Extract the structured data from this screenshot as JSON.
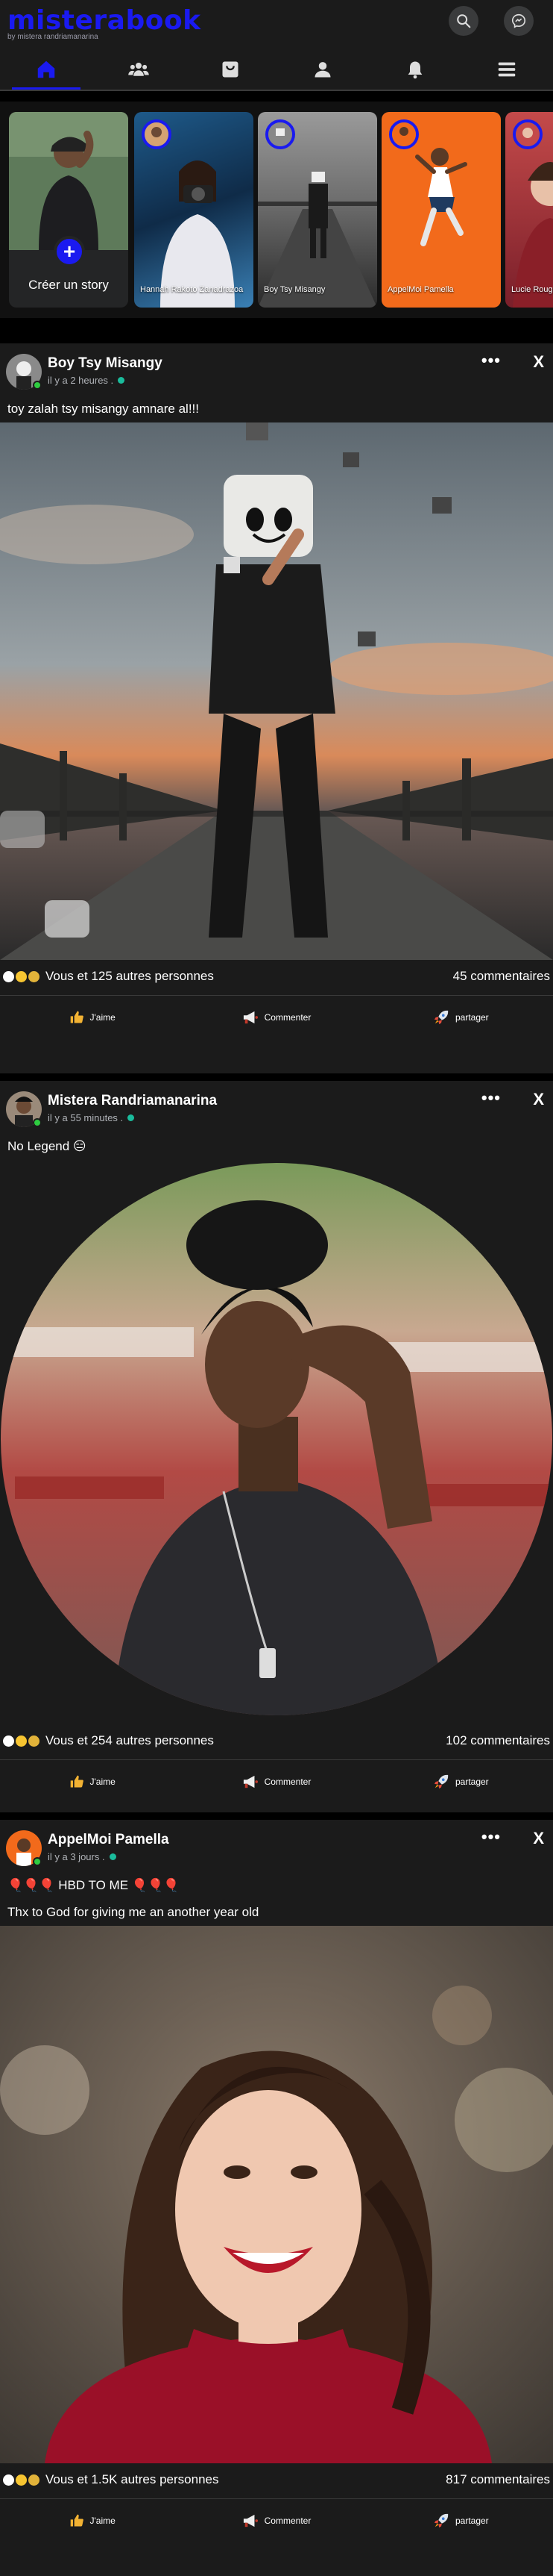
{
  "header": {
    "logo": "misterabook",
    "subtitle": "by mistera randriamanarina",
    "search_icon": "search-icon",
    "messenger_icon": "messenger-icon",
    "accent": "#1a1af0"
  },
  "nav": [
    {
      "icon": "home-icon",
      "active": true
    },
    {
      "icon": "friends-icon",
      "active": false
    },
    {
      "icon": "marketplace-icon",
      "active": false
    },
    {
      "icon": "profile-icon",
      "active": false
    },
    {
      "icon": "bell-icon",
      "active": false
    },
    {
      "icon": "menu-icon",
      "active": false
    }
  ],
  "stories": {
    "create_label": "Créer un story",
    "items": [
      {
        "name": "Hannah Rakoto Zanadrazoa"
      },
      {
        "name": "Boy Tsy Misangy"
      },
      {
        "name": "AppelMoi Pamella"
      },
      {
        "name": "Lucie Rouge"
      }
    ]
  },
  "actions": {
    "like": "J'aime",
    "comment": "Commenter",
    "share": "partager"
  },
  "posts": [
    {
      "author": "Boy Tsy Misangy",
      "time": "il y a 2 heures .",
      "text": "toy zalah tsy misangy amnare al!!!",
      "text2": "",
      "reactions": "Vous et 125 autres personnes",
      "comments": "45 commentaires"
    },
    {
      "author": "Mistera Randriamanarina",
      "time": "il y a 55 minutes .",
      "text": "No Legend 😑",
      "text2": "",
      "reactions": "Vous et 254 autres personnes",
      "comments": "102 commentaires"
    },
    {
      "author": "AppelMoi Pamella",
      "time": "il y a 3 jours .",
      "text": "🎈🎈🎈 HBD TO ME 🎈🎈🎈",
      "text2": "Thx to God for giving me an another year old",
      "reactions": "Vous et 1.5K autres personnes",
      "comments": "817 commentaires"
    }
  ]
}
